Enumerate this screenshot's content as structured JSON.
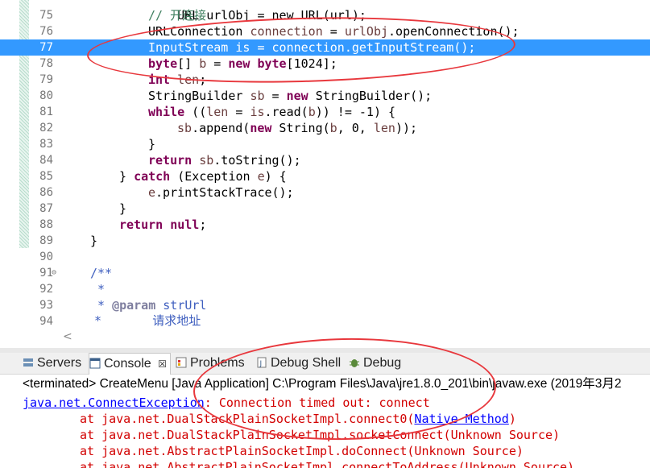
{
  "editor": {
    "line_numbers": [
      "75",
      "76",
      "77",
      "78",
      "79",
      "80",
      "81",
      "82",
      "83",
      "84",
      "85",
      "86",
      "87",
      "88",
      "89",
      "90",
      "91",
      "92",
      "93",
      "94"
    ],
    "top_partial": "URL urlObj = new URL(url);",
    "lines": {
      "l75_comment": "// 开连接",
      "l76_a": "URLConnection ",
      "l76_b": "connection",
      "l76_c": " = ",
      "l76_d": "urlObj",
      "l76_e": ".openConnection();",
      "l77": "InputStream is = connection.getInputStream();",
      "l78_kw1": "byte",
      "l78_a": "[] ",
      "l78_b": "b",
      "l78_c": " = ",
      "l78_kw2": "new",
      "l78_d": " ",
      "l78_kw3": "byte",
      "l78_e": "[1024];",
      "l79_kw": "int",
      "l79_a": " ",
      "l79_b": "len",
      "l79_c": ";",
      "l80_a": "StringBuilder ",
      "l80_b": "sb",
      "l80_c": " = ",
      "l80_kw": "new",
      "l80_d": " StringBuilder();",
      "l81_kw": "while",
      "l81_a": " ((",
      "l81_b": "len",
      "l81_c": " = ",
      "l81_d": "is",
      "l81_e": ".read(",
      "l81_f": "b",
      "l81_g": ")) != -1) {",
      "l82_a": "sb",
      "l82_b": ".append(",
      "l82_kw": "new",
      "l82_c": " String(",
      "l82_d": "b",
      "l82_e": ", 0, ",
      "l82_f": "len",
      "l82_g": "));",
      "l83": "}",
      "l84_kw": "return",
      "l84_a": " ",
      "l84_b": "sb",
      "l84_c": ".toString();",
      "l85_a": "} ",
      "l85_kw": "catch",
      "l85_b": " (Exception ",
      "l85_c": "e",
      "l85_d": ") {",
      "l86_a": "e",
      "l86_b": ".printStackTrace();",
      "l87": "}",
      "l88_kw1": "return",
      "l88_a": " ",
      "l88_kw2": "null",
      "l88_b": ";",
      "l89": "}",
      "l91": "/**",
      "l92": "*",
      "l93_a": "* ",
      "l93_tag": "@param",
      "l93_b": " strUrl",
      "l94": "*       请求地址"
    },
    "fold_marker": "⊖",
    "scroll_arrow": "<"
  },
  "tabs": [
    {
      "label": "Servers",
      "icon": "servers-icon"
    },
    {
      "label": "Console",
      "icon": "console-icon",
      "close": "☒"
    },
    {
      "label": "Problems",
      "icon": "problems-icon"
    },
    {
      "label": "Debug Shell",
      "icon": "debug-shell-icon"
    },
    {
      "label": "Debug",
      "icon": "debug-icon"
    }
  ],
  "console": {
    "header": "<terminated> CreateMenu [Java Application] C:\\Program Files\\Java\\jre1.8.0_201\\bin\\javaw.exe (2019年3月2",
    "exception_class": "java.net.ConnectException",
    "exception_msg": ": Connection timed out: connect",
    "stack": [
      {
        "prefix": "at java.net.DualStackPlainSocketImpl.connect0(",
        "link": "Native Method",
        "suffix": ")"
      },
      {
        "prefix": "at java.net.DualStackPlainSocketImpl.socketConnect(Unknown Source)",
        "link": "",
        "suffix": ""
      },
      {
        "prefix": "at java.net.AbstractPlainSocketImpl.doConnect(Unknown Source)",
        "link": "",
        "suffix": ""
      },
      {
        "prefix": "at java.net.AbstractPlainSocketImpl.connectToAddress(Unknown Source)",
        "link": "",
        "suffix": ""
      }
    ]
  },
  "colors": {
    "highlight": "#3399ff",
    "annotation": "#e8383d",
    "keyword": "#7f0055",
    "error": "#d20000"
  }
}
